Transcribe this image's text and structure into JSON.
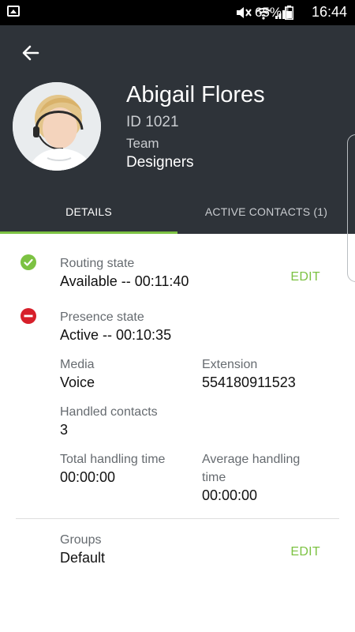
{
  "status_bar": {
    "battery": "65%",
    "time": "16:44"
  },
  "profile": {
    "name": "Abigail Flores",
    "id": "ID 1021",
    "team_label": "Team",
    "team_name": "Designers"
  },
  "tabs": [
    {
      "label": "DETAILS",
      "selected": true
    },
    {
      "label": "ACTIVE CONTACTS (1)",
      "selected": false
    }
  ],
  "details": {
    "routing_state": {
      "label": "Routing state",
      "value": "Available -- 00:11:40",
      "edit": "EDIT"
    },
    "presence_state": {
      "label": "Presence state",
      "value": "Active -- 00:10:35"
    },
    "media": {
      "label": "Media",
      "value": "Voice"
    },
    "extension": {
      "label": "Extension",
      "value": "554180911523"
    },
    "handled_contacts": {
      "label": "Handled contacts",
      "value": "3"
    },
    "total_handling_time": {
      "label": "Total handling time",
      "value": "00:00:00"
    },
    "average_handling_time": {
      "label_line1": "Average handling",
      "label_line2": "time",
      "value": "00:00:00"
    },
    "groups": {
      "label": "Groups",
      "value": "Default",
      "edit": "EDIT"
    }
  },
  "colors": {
    "header_bg": "#2e3339",
    "accent": "#7cc242",
    "error": "#d71f2a"
  }
}
